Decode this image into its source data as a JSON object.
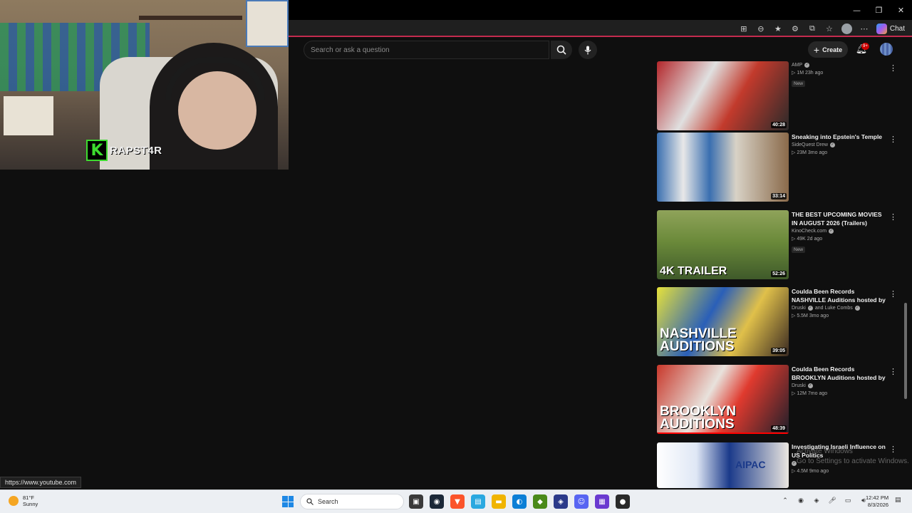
{
  "window": {
    "minimize": "—",
    "restore": "❐",
    "close": "✕"
  },
  "browser": {
    "chat_label": "Chat"
  },
  "youtube": {
    "search_placeholder": "Search or ask a question",
    "create_label": "Create",
    "notification_count": "9+"
  },
  "webcam": {
    "logo_letter": "K",
    "streamer_name": "RAPST4R"
  },
  "videos": [
    {
      "title": "",
      "channel": "AMP",
      "views": "1M",
      "age": "23h ago",
      "badge": "New",
      "duration": "40:28",
      "overlay": ""
    },
    {
      "title": "Sneaking into Epstein's Temple",
      "channel": "SideQuest Drew",
      "views": "23M",
      "age": "3mo ago",
      "badge": "",
      "duration": "33:14",
      "overlay": ""
    },
    {
      "title": "THE BEST UPCOMING MOVIES IN AUGUST 2026 (Trailers)",
      "channel": "KinoCheck.com",
      "views": "49K",
      "age": "2d ago",
      "badge": "New",
      "duration": "52:26",
      "overlay": "4K TRAILER"
    },
    {
      "title": "Coulda Been Records NASHVILLE Auditions hosted by Druski & Luk...",
      "channel": "Druski",
      "channel_extra": "and Luke Combs",
      "views": "5.5M",
      "age": "3mo ago",
      "badge": "",
      "duration": "39:05",
      "overlay": "NASHVILLE AUDITIONS"
    },
    {
      "title": "Coulda Been Records BROOKLYN Auditions hosted by Druski & ...",
      "channel": "Druski",
      "views": "12M",
      "age": "7mo ago",
      "badge": "",
      "duration": "48:39",
      "overlay": "BROOKLYN AUDITIONS"
    },
    {
      "title": "Investigating Israeli Influence on US Politics",
      "channel": "",
      "views": "4.5M",
      "age": "9mo ago",
      "badge": "",
      "duration": "",
      "overlay": "AIPAC"
    }
  ],
  "status_url": "https://www.youtube.com",
  "watermark": {
    "line1": "Activate Windows",
    "line2": "Go to Settings to activate Windows."
  },
  "taskbar": {
    "temperature": "81°F",
    "condition": "Sunny",
    "search_label": "Search",
    "time": "12:42 PM",
    "date": "8/3/2026"
  },
  "colors": {
    "accent_red": "#ff0000",
    "background": "#0f0f0f",
    "druski_badge": "#cc0000"
  }
}
